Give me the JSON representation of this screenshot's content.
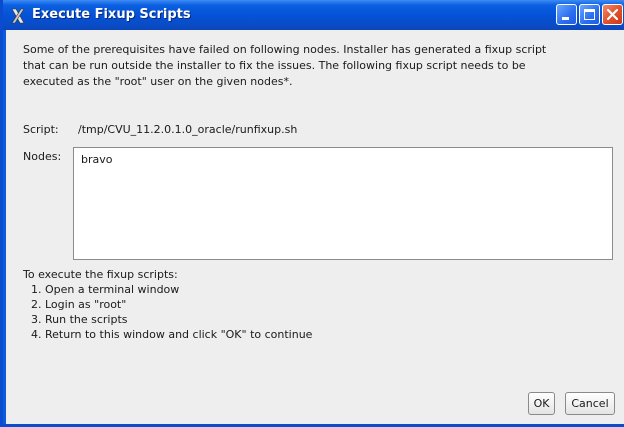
{
  "window": {
    "title": "Execute Fixup Scripts",
    "icon": "x-logo-icon"
  },
  "titlebar_buttons": [
    "minimize-icon",
    "maximize-icon",
    "close-icon"
  ],
  "description": {
    "line1": "Some of the prerequisites have failed on following nodes. Installer has generated a fixup script",
    "line2": "that can be run outside the installer to fix the issues. The following fixup script needs to be",
    "line3": "executed as the \"root\" user on the given nodes*."
  },
  "script": {
    "label": "Script:",
    "path": "/tmp/CVU_11.2.0.1.0_oracle/runfixup.sh"
  },
  "nodes": {
    "label": "Nodes:",
    "items": [
      "bravo"
    ]
  },
  "instructions": {
    "heading": "To execute the fixup scripts:",
    "steps": [
      "1. Open a terminal window",
      "2. Login as \"root\"",
      "3. Run the scripts",
      "4. Return to this window and click \"OK\" to continue"
    ]
  },
  "buttons": {
    "ok": "OK",
    "cancel": "Cancel"
  }
}
